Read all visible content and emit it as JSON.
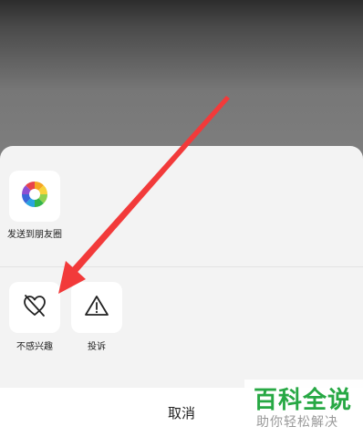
{
  "share_sheet": {
    "items_row1": [
      {
        "label": "发送到朋友圈",
        "icon": "moments-shutter-icon"
      }
    ],
    "items_row2": [
      {
        "label": "不感兴趣",
        "icon": "broken-heart-icon"
      },
      {
        "label": "投诉",
        "icon": "warning-triangle-icon"
      }
    ],
    "cancel_label": "取消"
  },
  "watermark": {
    "title": "百科全说",
    "subtitle": "助你轻松解决"
  },
  "annotation": {
    "color": "#f23a3a"
  }
}
